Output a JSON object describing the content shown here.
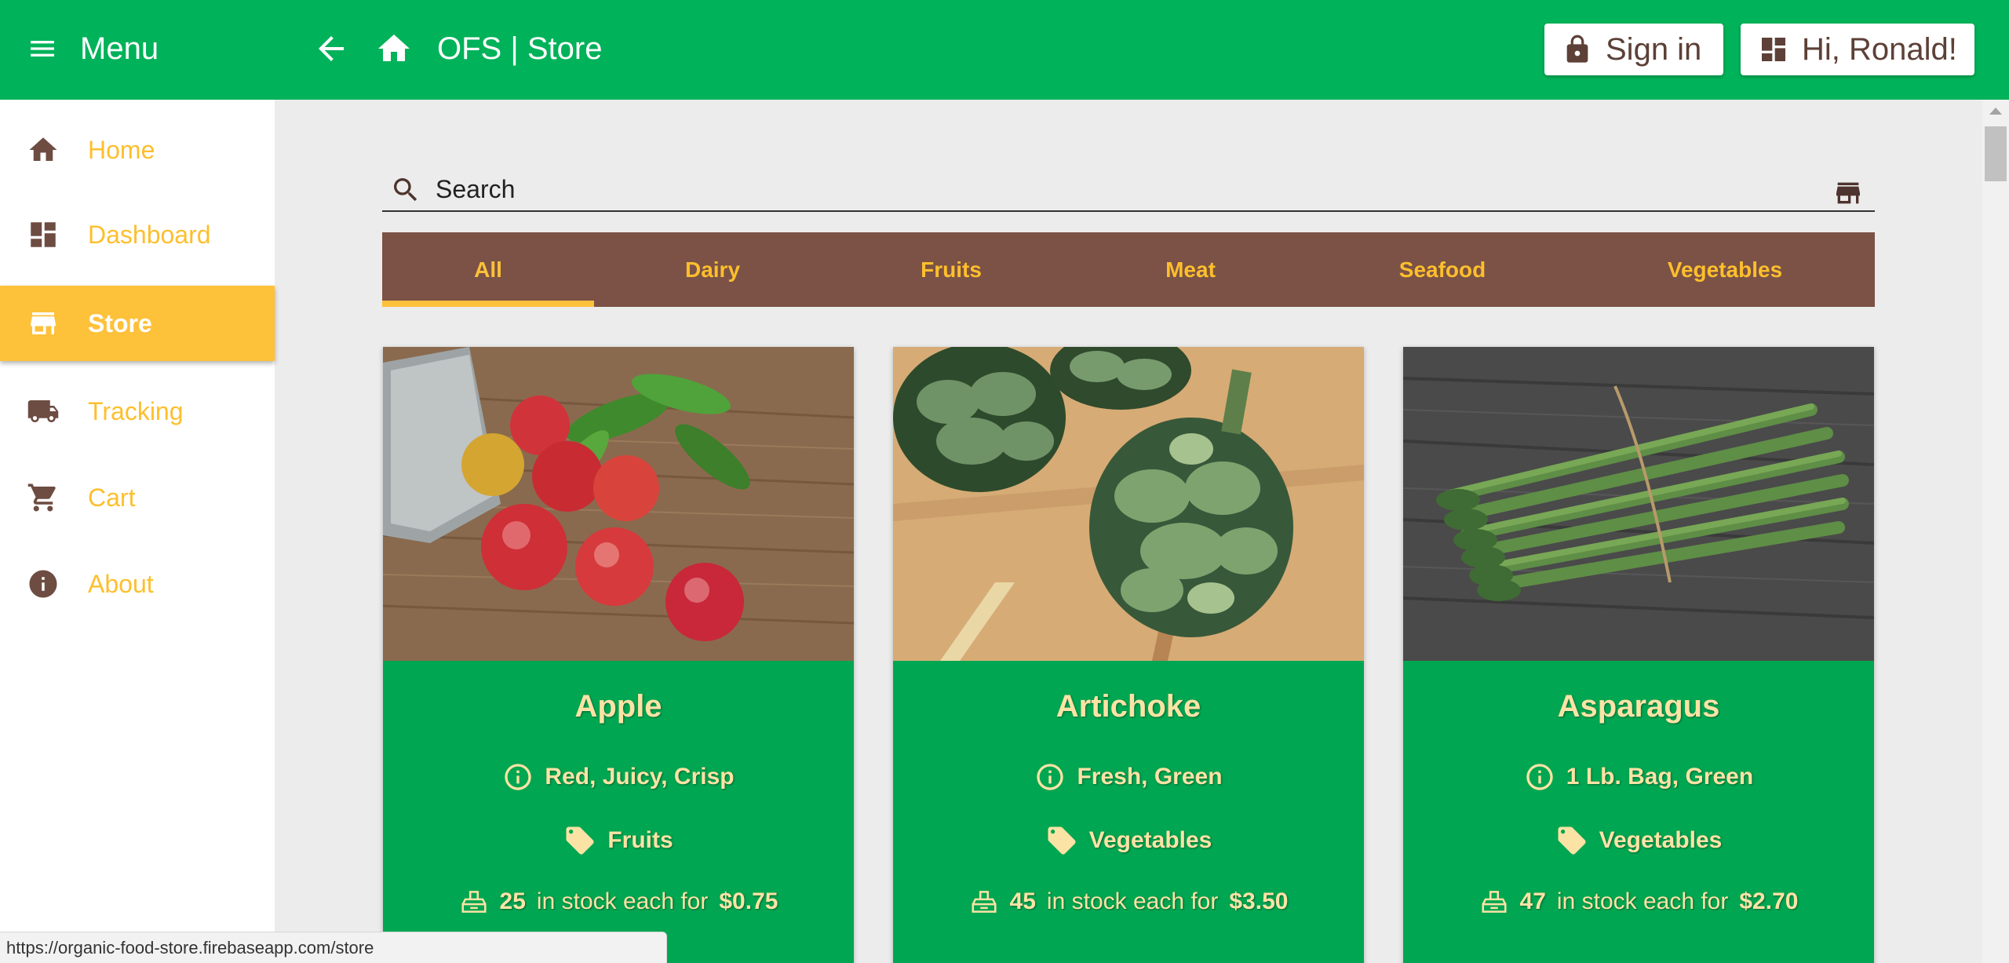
{
  "header": {
    "menu_label": "Menu",
    "title": "OFS | Store",
    "signin_label": "Sign in",
    "user_greeting": "Hi, Ronald!"
  },
  "sidebar": {
    "items": [
      {
        "label": "Home",
        "icon": "home-icon"
      },
      {
        "label": "Dashboard",
        "icon": "dashboard-icon"
      },
      {
        "label": "Store",
        "icon": "store-icon",
        "active": true
      },
      {
        "label": "Tracking",
        "icon": "truck-icon"
      },
      {
        "label": "Cart",
        "icon": "cart-icon"
      },
      {
        "label": "About",
        "icon": "info-icon"
      }
    ]
  },
  "search": {
    "placeholder": "Search",
    "value": ""
  },
  "tabs": [
    {
      "label": "All",
      "active": true
    },
    {
      "label": "Dairy"
    },
    {
      "label": "Fruits"
    },
    {
      "label": "Meat"
    },
    {
      "label": "Seafood"
    },
    {
      "label": "Vegetables"
    }
  ],
  "products": [
    {
      "name": "Apple",
      "description": "Red, Juicy, Crisp",
      "category": "Fruits",
      "stock": "25",
      "stock_text": "in stock each for",
      "price": "$0.75"
    },
    {
      "name": "Artichoke",
      "description": "Fresh, Green",
      "category": "Vegetables",
      "stock": "45",
      "stock_text": "in stock each for",
      "price": "$3.50"
    },
    {
      "name": "Asparagus",
      "description": "1 Lb. Bag, Green",
      "category": "Vegetables",
      "stock": "47",
      "stock_text": "in stock each for",
      "price": "$2.70"
    }
  ],
  "status_bar": {
    "url": "https://organic-food-store.firebaseapp.com/store"
  },
  "colors": {
    "header_green": "#00b259",
    "card_green": "#00a651",
    "brown": "#7b5245",
    "accent_yellow": "#fdc13a",
    "card_text": "#fbe3a5"
  }
}
